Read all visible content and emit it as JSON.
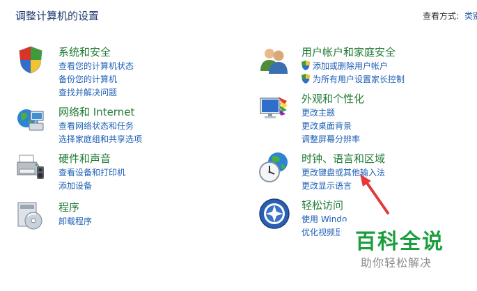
{
  "header": {
    "title": "调整计算机的设置",
    "view_by_label": "查看方式:",
    "view_by_value": "类别"
  },
  "categories": [
    {
      "title": "系统和安全",
      "icon": "shield-icon",
      "links": [
        "查看您的计算机状态",
        "备份您的计算机",
        "查找并解决问题"
      ]
    },
    {
      "title": "网络和 Internet",
      "icon": "network-globe-icon",
      "links": [
        "查看网络状态和任务",
        "选择家庭组和共享选项"
      ]
    },
    {
      "title": "硬件和声音",
      "icon": "printer-icon",
      "links": [
        "查看设备和打印机",
        "添加设备"
      ]
    },
    {
      "title": "程序",
      "icon": "programs-disc-icon",
      "links": [
        "卸载程序"
      ]
    },
    {
      "title": "用户帐户和家庭安全",
      "icon": "users-icon",
      "links": [
        "添加或删除用户帐户",
        "为所有用户设置家长控制"
      ]
    },
    {
      "title": "外观和个性化",
      "icon": "monitor-palette-icon",
      "links": [
        "更改主题",
        "更改桌面背景",
        "调整屏幕分辨率"
      ]
    },
    {
      "title": "时钟、语言和区域",
      "icon": "clock-globe-icon",
      "links": [
        "更改键盘或其他输入法",
        "更改显示语言"
      ]
    },
    {
      "title": "轻松访问",
      "icon": "ease-of-access-icon",
      "links": [
        "使用 Windo",
        "优化视频显"
      ]
    }
  ],
  "watermark": {
    "brand": "百科全说",
    "tagline": "助你轻松解决"
  },
  "colors": {
    "title_green": "#1f7a34",
    "link_blue": "#1d5fb5",
    "arrow_red": "#e23a3a",
    "watermark_green": "#1b9e3e"
  }
}
